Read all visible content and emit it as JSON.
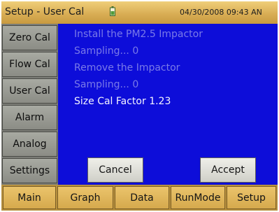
{
  "header": {
    "title": "Setup - User Cal",
    "battery_icon": "battery-icon",
    "datetime": "04/30/2008 09:43 AN"
  },
  "sidebar": {
    "items": [
      {
        "label": "Zero Cal"
      },
      {
        "label": "Flow Cal"
      },
      {
        "label": "User Cal"
      },
      {
        "label": "Alarm"
      },
      {
        "label": "Analog"
      },
      {
        "label": "Settings"
      }
    ]
  },
  "main": {
    "lines": [
      "Install the PM2.5 Impactor",
      "Sampling...  0",
      "Remove the Impactor",
      "Sampling...  0",
      "Size Cal Factor 1.23"
    ],
    "cancel_label": "Cancel",
    "accept_label": "Accept"
  },
  "bottom_nav": {
    "items": [
      {
        "label": "Main"
      },
      {
        "label": "Graph"
      },
      {
        "label": "Data"
      },
      {
        "label": "RunMode"
      },
      {
        "label": "Setup"
      }
    ]
  },
  "colors": {
    "content_bg": "#0d0dd9",
    "dim_text": "#7a7ae8",
    "bright_text": "#f4f4ff",
    "title_bar": "#d9ae55",
    "sidebar_tab": "#8b8c85"
  }
}
